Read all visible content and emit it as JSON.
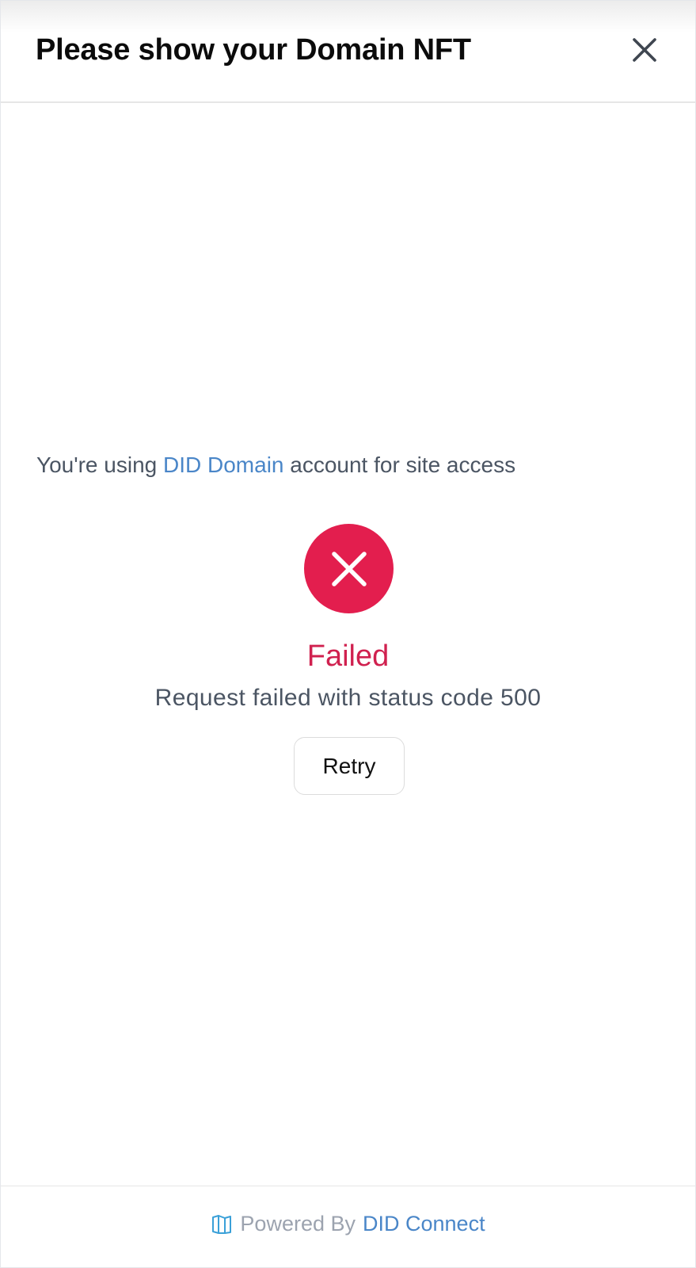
{
  "dialog": {
    "title": "Please show your Domain NFT",
    "close_icon": "close-icon"
  },
  "account": {
    "prefix": "You're using ",
    "link_text": "DID Domain",
    "suffix": " account for site access"
  },
  "status": {
    "icon": "error-x-icon",
    "title": "Failed",
    "message": "Request failed with status code 500",
    "retry_label": "Retry"
  },
  "footer": {
    "logo_icon": "did-connect-logo-icon",
    "powered_by": "Powered By",
    "brand": "DID Connect"
  },
  "colors": {
    "error": "#e31e4e",
    "error_text": "#d0214f",
    "link": "#4a86c8",
    "body_text": "#4b5563"
  }
}
